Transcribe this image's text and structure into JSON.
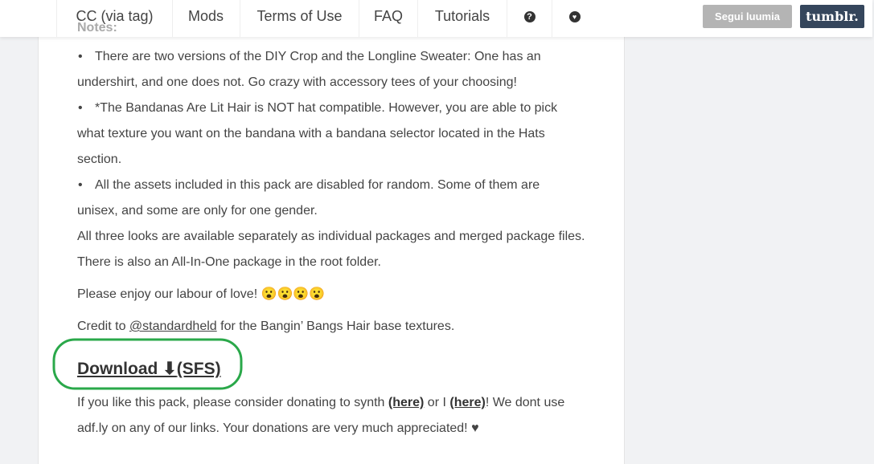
{
  "nav": {
    "items": [
      "CC (via tag)",
      "Mods",
      "Terms of Use",
      "FAQ",
      "Tutorials"
    ],
    "question_icon": "question-circle-icon",
    "heart_icon": "heart-circle-icon",
    "follow_label": "Segui luumia",
    "tumblr_label": "tumblr."
  },
  "post": {
    "notes_heading": "Notes:",
    "bullet_char": "•",
    "lines": [
      "There are two versions of the DIY Crop and the Longline Sweater: One has an",
      "undershirt, and one does not. Go crazy with accessory tees of your choosing!",
      "*The Bandanas Are Lit Hair is NOT hat compatible. However, you are able to pick",
      "what texture you want on the bandana with a bandana selector located in the Hats",
      "section.",
      "All the assets included in this pack are disabled for random. Some of them are",
      "unisex, and some are only for one gender.",
      "All three looks are available separately as individual packages and merged package files.",
      "There is also an All-In-One package in the root folder."
    ],
    "enjoy": "Please enjoy our labour of love! 😮😮😮😮",
    "credit_prefix": "Credit to ",
    "credit_link": "@standardheld",
    "credit_suffix": " for the Bangin’ Bangs Hair base textures.",
    "download_label": "Download ⬇",
    "download_sfs": "(SFS)",
    "donate_1": "If you like this pack, please consider donating to synth ",
    "donate_link1": "(here)",
    "donate_2": " or I ",
    "donate_link2": "(here)",
    "donate_3": "! We dont use",
    "donate_line2": "adf.ly on any of our links. Your donations are very much appreciated!  ♥"
  },
  "colors": {
    "annotation_circle": "#2aa84a",
    "tumblr": "#35465c",
    "follow": "#b4b4b4"
  }
}
